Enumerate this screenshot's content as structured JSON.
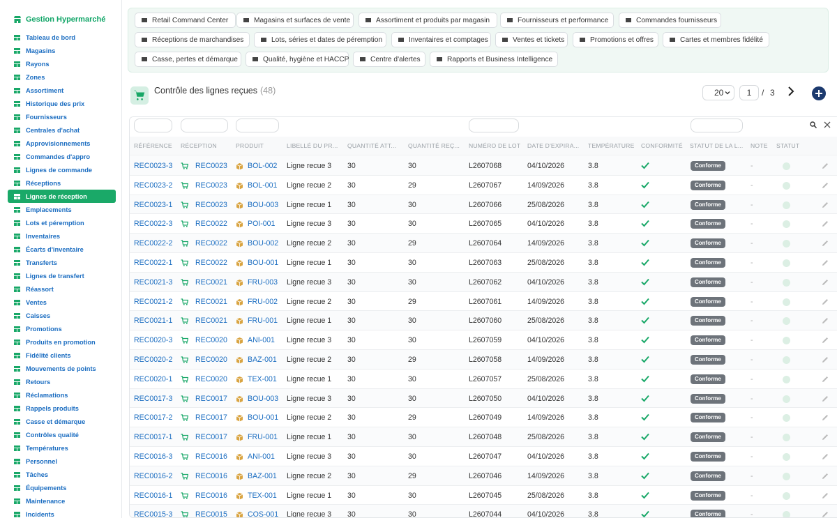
{
  "app": {
    "title": "Gestion Hypermarché"
  },
  "sidebar": {
    "items": [
      {
        "label": "Tableau de bord",
        "icon": "dashboard-icon"
      },
      {
        "label": "Magasins",
        "icon": "store-icon"
      },
      {
        "label": "Rayons",
        "icon": "boxes-icon"
      },
      {
        "label": "Zones",
        "icon": "layers-icon"
      },
      {
        "label": "Assortiment",
        "icon": "tags-icon"
      },
      {
        "label": "Historique des prix",
        "icon": "history-icon"
      },
      {
        "label": "Fournisseurs",
        "icon": "truck-icon"
      },
      {
        "label": "Centrales d'achat",
        "icon": "handshake-icon"
      },
      {
        "label": "Approvisionnements",
        "icon": "dolly-icon"
      },
      {
        "label": "Commandes d'appro",
        "icon": "cart-icon"
      },
      {
        "label": "Lignes de commande",
        "icon": "list-icon"
      },
      {
        "label": "Réceptions",
        "icon": "truck-loading-icon"
      },
      {
        "label": "Lignes de réception",
        "icon": "clipboard-check-icon",
        "active": true
      },
      {
        "label": "Emplacements",
        "icon": "map-marker-icon"
      },
      {
        "label": "Lots et péremption",
        "icon": "cubes-icon"
      },
      {
        "label": "Inventaires",
        "icon": "clipboard-icon"
      },
      {
        "label": "Écarts d'inventaire",
        "icon": "balance-icon"
      },
      {
        "label": "Transferts",
        "icon": "exchange-icon"
      },
      {
        "label": "Lignes de transfert",
        "icon": "list-ul-icon"
      },
      {
        "label": "Réassort",
        "icon": "redo-icon"
      },
      {
        "label": "Ventes",
        "icon": "receipt-icon"
      },
      {
        "label": "Caisses",
        "icon": "cash-register-icon"
      },
      {
        "label": "Promotions",
        "icon": "percent-icon"
      },
      {
        "label": "Produits en promotion",
        "icon": "tag-icon"
      },
      {
        "label": "Fidélité clients",
        "icon": "id-card-icon"
      },
      {
        "label": "Mouvements de points",
        "icon": "star-icon"
      },
      {
        "label": "Retours",
        "icon": "undo-icon"
      },
      {
        "label": "Réclamations",
        "icon": "comment-icon"
      },
      {
        "label": "Rappels produits",
        "icon": "bullhorn-icon"
      },
      {
        "label": "Casse et démarque",
        "icon": "trash-icon"
      },
      {
        "label": "Contrôles qualité",
        "icon": "check-square-icon"
      },
      {
        "label": "Températures",
        "icon": "thermometer-icon"
      },
      {
        "label": "Personnel",
        "icon": "user-icon"
      },
      {
        "label": "Tâches",
        "icon": "tasks-icon"
      },
      {
        "label": "Équipements",
        "icon": "cogs-icon"
      },
      {
        "label": "Maintenance",
        "icon": "wrench-icon"
      },
      {
        "label": "Incidents",
        "icon": "warning-icon"
      }
    ]
  },
  "modules": [
    {
      "label": "Retail Command Center",
      "icon": "gauge-icon"
    },
    {
      "label": "Magasins et surfaces de vente",
      "icon": "store-icon"
    },
    {
      "label": "Assortiment et produits par magasin",
      "icon": "tags-icon"
    },
    {
      "label": "Fournisseurs et performance",
      "icon": "truck-icon"
    },
    {
      "label": "Commandes fournisseurs",
      "icon": "cart-icon"
    },
    {
      "label": "Réceptions de marchandises",
      "icon": "truck-loading-icon"
    },
    {
      "label": "Lots, séries et dates de péremption",
      "icon": "cubes-icon"
    },
    {
      "label": "Inventaires et comptages",
      "icon": "clipboard-icon"
    },
    {
      "label": "Ventes et tickets",
      "icon": "receipt-icon"
    },
    {
      "label": "Promotions et offres",
      "icon": "percent-icon"
    },
    {
      "label": "Cartes et membres fidélité",
      "icon": "id-card-icon"
    },
    {
      "label": "Casse, pertes et démarque",
      "icon": "trash-icon"
    },
    {
      "label": "Qualité, hygiène et HACCP",
      "icon": "clipboard-check-icon"
    },
    {
      "label": "Centre d'alertes",
      "icon": "bell-icon"
    },
    {
      "label": "Rapports et Business Intelligence",
      "icon": "chart-pie-icon"
    }
  ],
  "page": {
    "title": "Contrôle des lignes reçues",
    "count": "(48)",
    "page_size": "20",
    "current_page": "1",
    "page_sep": "/",
    "total_pages": "3"
  },
  "table": {
    "columns": [
      "Référence",
      "Réception",
      "Produit",
      "Libellé du pr...",
      "Quantité att...",
      "Quantité reç...",
      "Numéro de lot",
      "Date d'expira...",
      "Température",
      "Conformité",
      "Statut de la l...",
      "Note",
      "Statut"
    ],
    "rows": [
      {
        "ref": "REC0023-3",
        "reception": "REC0023",
        "produit": "BOL-002",
        "libelle": "Ligne recue 3",
        "qte_att": "30",
        "qte_rec": "30",
        "lot": "L2607068",
        "date": "04/10/2026",
        "temp": "3.8",
        "statut_ligne": "Conforme",
        "note": "-"
      },
      {
        "ref": "REC0023-2",
        "reception": "REC0023",
        "produit": "BOL-001",
        "libelle": "Ligne recue 2",
        "qte_att": "30",
        "qte_rec": "29",
        "lot": "L2607067",
        "date": "14/09/2026",
        "temp": "3.8",
        "statut_ligne": "Conforme",
        "note": "-"
      },
      {
        "ref": "REC0023-1",
        "reception": "REC0023",
        "produit": "BOU-003",
        "libelle": "Ligne recue 1",
        "qte_att": "30",
        "qte_rec": "30",
        "lot": "L2607066",
        "date": "25/08/2026",
        "temp": "3.8",
        "statut_ligne": "Conforme",
        "note": "-"
      },
      {
        "ref": "REC0022-3",
        "reception": "REC0022",
        "produit": "POI-001",
        "libelle": "Ligne recue 3",
        "qte_att": "30",
        "qte_rec": "30",
        "lot": "L2607065",
        "date": "04/10/2026",
        "temp": "3.8",
        "statut_ligne": "Conforme",
        "note": "-"
      },
      {
        "ref": "REC0022-2",
        "reception": "REC0022",
        "produit": "BOU-002",
        "libelle": "Ligne recue 2",
        "qte_att": "30",
        "qte_rec": "29",
        "lot": "L2607064",
        "date": "14/09/2026",
        "temp": "3.8",
        "statut_ligne": "Conforme",
        "note": "-"
      },
      {
        "ref": "REC0022-1",
        "reception": "REC0022",
        "produit": "BOU-001",
        "libelle": "Ligne recue 1",
        "qte_att": "30",
        "qte_rec": "30",
        "lot": "L2607063",
        "date": "25/08/2026",
        "temp": "3.8",
        "statut_ligne": "Conforme",
        "note": "-"
      },
      {
        "ref": "REC0021-3",
        "reception": "REC0021",
        "produit": "FRU-003",
        "libelle": "Ligne recue 3",
        "qte_att": "30",
        "qte_rec": "30",
        "lot": "L2607062",
        "date": "04/10/2026",
        "temp": "3.8",
        "statut_ligne": "Conforme",
        "note": "-"
      },
      {
        "ref": "REC0021-2",
        "reception": "REC0021",
        "produit": "FRU-002",
        "libelle": "Ligne recue 2",
        "qte_att": "30",
        "qte_rec": "29",
        "lot": "L2607061",
        "date": "14/09/2026",
        "temp": "3.8",
        "statut_ligne": "Conforme",
        "note": "-"
      },
      {
        "ref": "REC0021-1",
        "reception": "REC0021",
        "produit": "FRU-001",
        "libelle": "Ligne recue 1",
        "qte_att": "30",
        "qte_rec": "30",
        "lot": "L2607060",
        "date": "25/08/2026",
        "temp": "3.8",
        "statut_ligne": "Conforme",
        "note": "-"
      },
      {
        "ref": "REC0020-3",
        "reception": "REC0020",
        "produit": "ANI-001",
        "libelle": "Ligne recue 3",
        "qte_att": "30",
        "qte_rec": "30",
        "lot": "L2607059",
        "date": "04/10/2026",
        "temp": "3.8",
        "statut_ligne": "Conforme",
        "note": "-"
      },
      {
        "ref": "REC0020-2",
        "reception": "REC0020",
        "produit": "BAZ-001",
        "libelle": "Ligne recue 2",
        "qte_att": "30",
        "qte_rec": "29",
        "lot": "L2607058",
        "date": "14/09/2026",
        "temp": "3.8",
        "statut_ligne": "Conforme",
        "note": "-"
      },
      {
        "ref": "REC0020-1",
        "reception": "REC0020",
        "produit": "TEX-001",
        "libelle": "Ligne recue 1",
        "qte_att": "30",
        "qte_rec": "30",
        "lot": "L2607057",
        "date": "25/08/2026",
        "temp": "3.8",
        "statut_ligne": "Conforme",
        "note": "-"
      },
      {
        "ref": "REC0017-3",
        "reception": "REC0017",
        "produit": "BOU-003",
        "libelle": "Ligne recue 3",
        "qte_att": "30",
        "qte_rec": "30",
        "lot": "L2607050",
        "date": "04/10/2026",
        "temp": "3.8",
        "statut_ligne": "Conforme",
        "note": "-"
      },
      {
        "ref": "REC0017-2",
        "reception": "REC0017",
        "produit": "BOU-001",
        "libelle": "Ligne recue 2",
        "qte_att": "30",
        "qte_rec": "29",
        "lot": "L2607049",
        "date": "14/09/2026",
        "temp": "3.8",
        "statut_ligne": "Conforme",
        "note": "-"
      },
      {
        "ref": "REC0017-1",
        "reception": "REC0017",
        "produit": "FRU-001",
        "libelle": "Ligne recue 1",
        "qte_att": "30",
        "qte_rec": "30",
        "lot": "L2607048",
        "date": "25/08/2026",
        "temp": "3.8",
        "statut_ligne": "Conforme",
        "note": "-"
      },
      {
        "ref": "REC0016-3",
        "reception": "REC0016",
        "produit": "ANI-001",
        "libelle": "Ligne recue 3",
        "qte_att": "30",
        "qte_rec": "30",
        "lot": "L2607047",
        "date": "04/10/2026",
        "temp": "3.8",
        "statut_ligne": "Conforme",
        "note": "-"
      },
      {
        "ref": "REC0016-2",
        "reception": "REC0016",
        "produit": "BAZ-001",
        "libelle": "Ligne recue 2",
        "qte_att": "30",
        "qte_rec": "29",
        "lot": "L2607046",
        "date": "14/09/2026",
        "temp": "3.8",
        "statut_ligne": "Conforme",
        "note": "-"
      },
      {
        "ref": "REC0016-1",
        "reception": "REC0016",
        "produit": "TEX-001",
        "libelle": "Ligne recue 1",
        "qte_att": "30",
        "qte_rec": "30",
        "lot": "L2607045",
        "date": "25/08/2026",
        "temp": "3.8",
        "statut_ligne": "Conforme",
        "note": "-"
      },
      {
        "ref": "REC0015-3",
        "reception": "REC0015",
        "produit": "COS-001",
        "libelle": "Ligne recue 3",
        "qte_att": "30",
        "qte_rec": "30",
        "lot": "L2607044",
        "date": "04/10/2026",
        "temp": "3.8",
        "statut_ligne": "Conforme",
        "note": "-"
      }
    ]
  },
  "colors": {
    "brand_green": "#19a868",
    "link_blue": "#1b6dc1",
    "badge_gray": "#6d737a",
    "add_button": "#1c3a6e"
  }
}
